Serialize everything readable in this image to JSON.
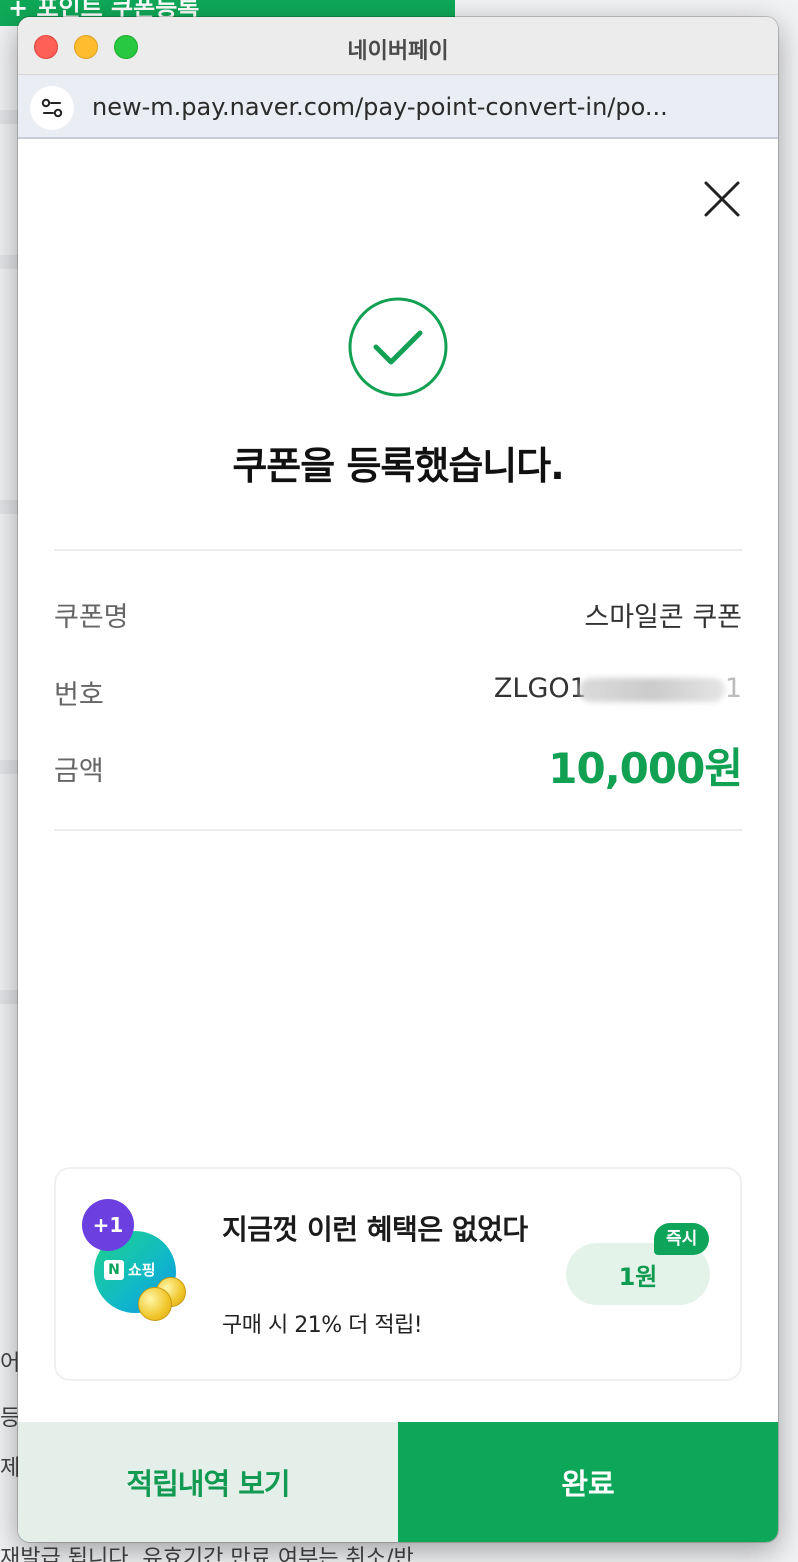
{
  "background_page": {
    "top_button_label": "+ 포인트 쿠폰등록",
    "bottom_text": "재발급 됩니다. 유효기간 만료 여부는 취소/반",
    "side_fragments": [
      "어 ",
      "등)",
      "제"
    ]
  },
  "window": {
    "title": "네이버페이",
    "url": "new-m.pay.naver.com/pay-point-convert-in/po..."
  },
  "content": {
    "headline": "쿠폰을 등록했습니다.",
    "details": {
      "coupon_name_label": "쿠폰명",
      "coupon_name_value": "스마일콘 쿠폰",
      "number_label": "번호",
      "number_value_visible": "ZLGO1",
      "number_value_end": "1",
      "amount_label": "금액",
      "amount_value": "10,000원"
    }
  },
  "banner": {
    "badge": "+1",
    "logo_letter": "N",
    "logo_text": "쇼핑",
    "title": "지금껏 이런 혜택은 없었다",
    "subtitle": "구매 시 21% 더 적립!",
    "reward": "1원",
    "tag": "즉시"
  },
  "footer": {
    "history_button": "적립내역 보기",
    "done_button": "완료"
  },
  "colors": {
    "brand_green": "#0ea75a",
    "amount_green": "#12a153",
    "badge_purple": "#6b3fe0"
  }
}
